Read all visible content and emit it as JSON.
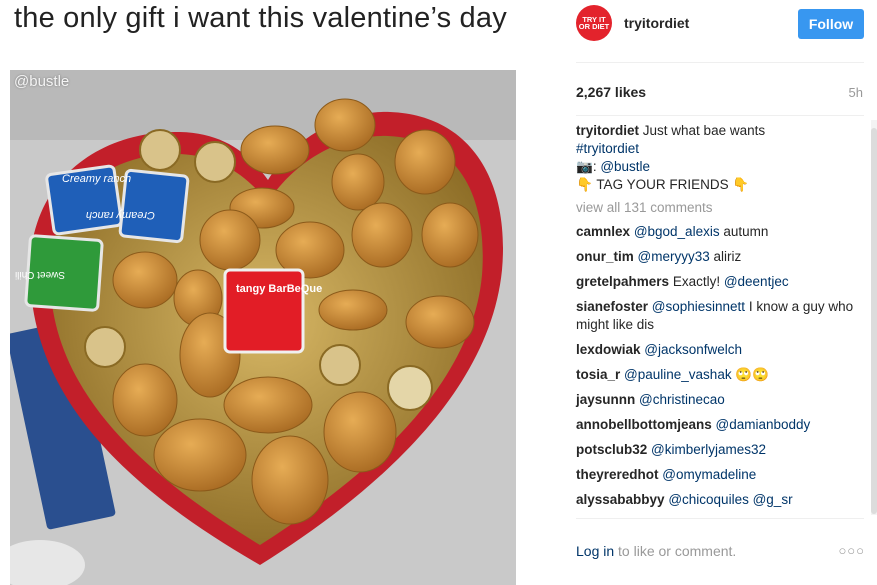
{
  "meme": {
    "caption": "the only gift i want this valentine’s day",
    "watermark": "@bustle"
  },
  "photo": {
    "packets": [
      "Creamy ranch",
      "Creamy ranch",
      "Sweet Chili",
      "tangy BarBeQue"
    ],
    "colors": {
      "box_red": "#c21f2a",
      "gold_liner": "#b8943e",
      "nugget": "#c98a35"
    }
  },
  "post": {
    "avatar_text": "TRY IT OR DIET",
    "username": "tryitordiet",
    "follow_label": "Follow",
    "likes": "2,267 likes",
    "time": "5h",
    "caption": {
      "user": "tryitordiet",
      "text": "Just what bae wants",
      "hashtag": "#tryitordiet",
      "camera_icon": "📷",
      "credit": "@bustle",
      "tag_line": "👇 TAG YOUR FRIENDS 👇"
    },
    "view_all": "view all 131 comments",
    "comments": [
      {
        "user": "camnlex",
        "mention": "@bgod_alexis",
        "text": " autumn"
      },
      {
        "user": "onur_tim",
        "mention": "@meryyy33",
        "text": " aliriz"
      },
      {
        "user": "gretelpahmers",
        "text": "Exactly! ",
        "mention_after": "@deentjec"
      },
      {
        "user": "sianefoster",
        "mention": "@sophiesinnett",
        "text": " I know a guy who might like dis"
      },
      {
        "user": "lexdowiak",
        "mention": "@jacksonfwelch",
        "text": ""
      },
      {
        "user": "tosia_r",
        "mention": "@pauline_vashak",
        "text": " 🙄🙄"
      },
      {
        "user": "jaysunnn",
        "mention": "@christinecao",
        "text": ""
      },
      {
        "user": "annobellbottomjeans",
        "mention": "@damianboddy",
        "text": ""
      },
      {
        "user": "potsclub32",
        "mention": "@kimberlyjames32",
        "text": ""
      },
      {
        "user": "theyreredhot",
        "mention": "@omymadeline",
        "text": ""
      },
      {
        "user": "alyssababbyy",
        "mention": "@chicoquiles",
        "text": " ",
        "mention_after": "@g_sr"
      }
    ],
    "login": {
      "link": "Log in",
      "text": " to like or comment."
    },
    "more": "○○○"
  },
  "colors": {
    "accent": "#3897f0",
    "link": "#003569",
    "muted": "#999999"
  }
}
